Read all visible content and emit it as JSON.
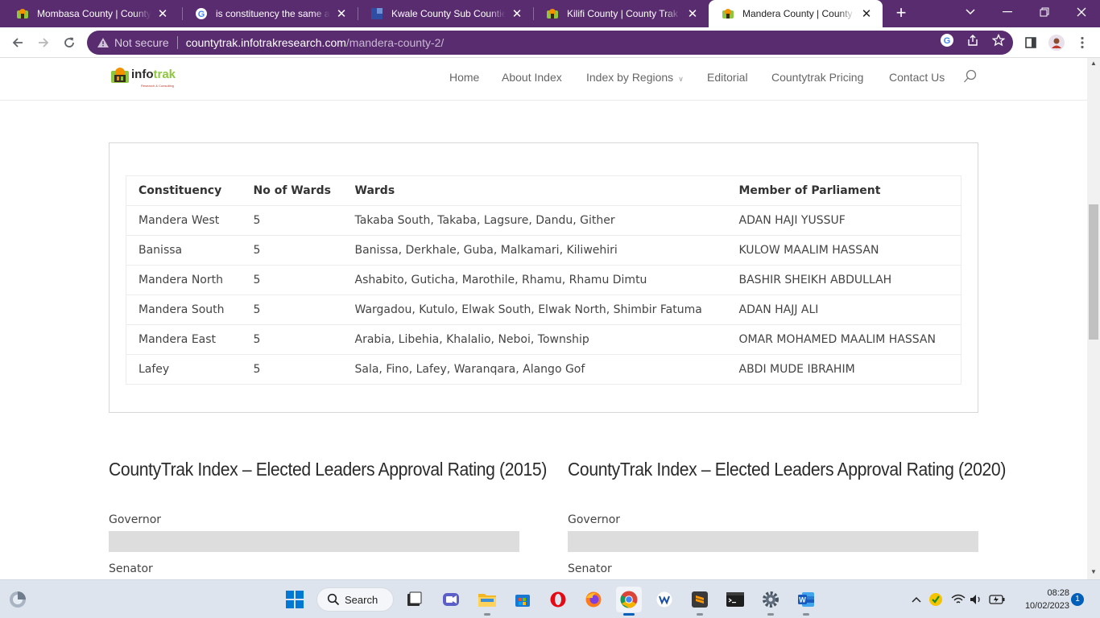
{
  "browser": {
    "tabs": [
      {
        "title": "Mombasa County | County Trak Kenya",
        "favicon": "infotrak-favicon"
      },
      {
        "title": "is constituency the same as sub county - Google Search",
        "favicon": "google-favicon"
      },
      {
        "title": "Kwale County Sub Counties",
        "favicon": "kwale-favicon"
      },
      {
        "title": "Kilifi County | County Trak Kenya",
        "favicon": "infotrak-favicon"
      },
      {
        "title": "Mandera County | County Trak Kenya",
        "favicon": "infotrak-favicon",
        "active": true
      }
    ],
    "security_label": "Not secure",
    "url_host": "countytrak.infotrakresearch.com",
    "url_path": "/mandera-county-2/"
  },
  "site": {
    "logo_text_1": "info",
    "logo_text_2": "trak",
    "logo_tagline": "Research & Consulting",
    "nav": [
      {
        "label": "Home"
      },
      {
        "label": "About Index"
      },
      {
        "label": "Index by Regions"
      },
      {
        "label": "Editorial"
      },
      {
        "label": "Countytrak Pricing"
      },
      {
        "label": "Contact Us"
      }
    ]
  },
  "constituency_table": {
    "headers": [
      "Constituency",
      "No of Wards",
      "Wards",
      "Member of Parliament"
    ],
    "rows": [
      [
        "Mandera West",
        "5",
        "Takaba South, Takaba, Lagsure, Dandu, Gither",
        "ADAN HAJI YUSSUF"
      ],
      [
        "Banissa",
        "5",
        "Banissa, Derkhale, Guba, Malkamari, Kiliwehiri",
        "KULOW MAALIM HASSAN"
      ],
      [
        "Mandera North",
        "5",
        "Ashabito, Guticha, Marothile, Rhamu, Rhamu Dimtu",
        "BASHIR SHEIKH ABDULLAH"
      ],
      [
        "Mandera South",
        "5",
        "Wargadou, Kutulo, Elwak South, Elwak North, Shimbir Fatuma",
        "ADAN HAJJ ALI"
      ],
      [
        "Mandera East",
        "5",
        "Arabia, Libehia, Khalalio, Neboi, Township",
        "OMAR MOHAMED MAALIM HASSAN"
      ],
      [
        "Lafey",
        "5",
        "Sala, Fino, Lafey, Waranqara, Alango Gof",
        "ABDI MUDE IBRAHIM"
      ]
    ]
  },
  "ratings": [
    {
      "heading": "CountyTrak Index – Elected Leaders Approval Rating (2015)",
      "items": [
        {
          "label": "Governor"
        },
        {
          "label": "Senator"
        }
      ]
    },
    {
      "heading": "CountyTrak Index – Elected Leaders Approval Rating (2020)",
      "items": [
        {
          "label": "Governor"
        },
        {
          "label": "Senator"
        }
      ]
    }
  ],
  "taskbar": {
    "search_label": "Search",
    "time": "08:28",
    "date": "10/02/2023",
    "notification_count": "1"
  },
  "colors": {
    "browser_frame": "#582c6e",
    "logo_green": "#8dc63f",
    "logo_orange": "#f39200",
    "taskbar": "#dde4ee"
  }
}
